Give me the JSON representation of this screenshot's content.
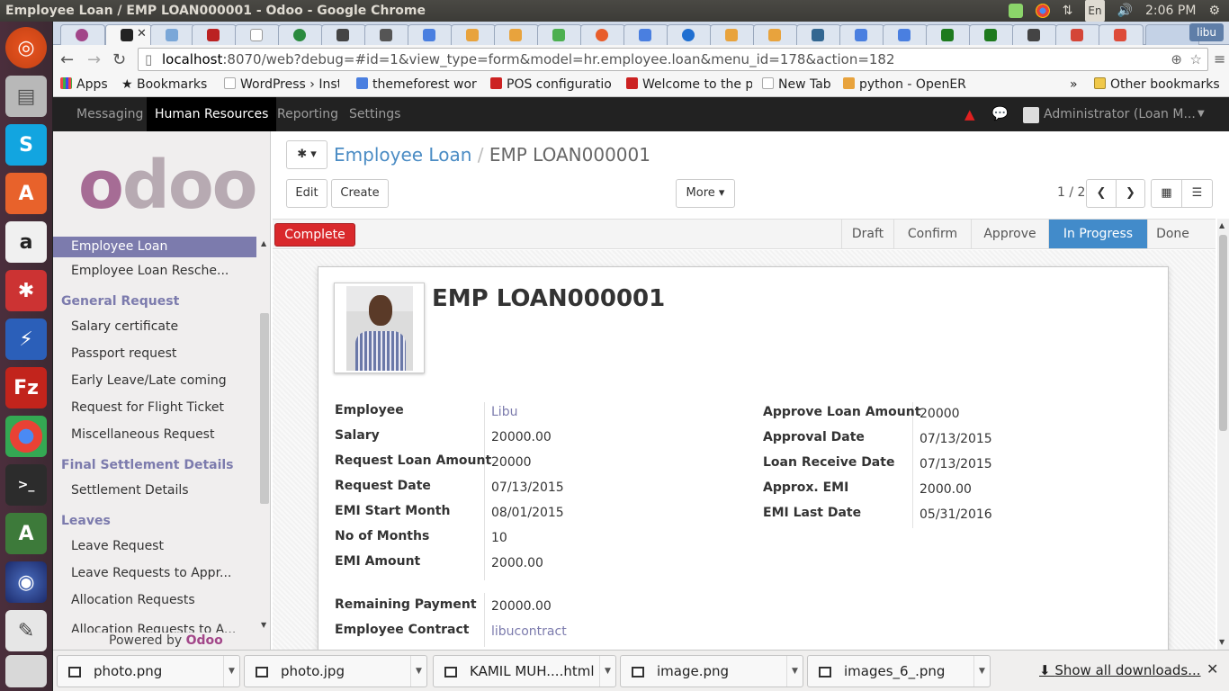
{
  "window": {
    "title": "Employee Loan / EMP LOAN000001 - Odoo - Google Chrome",
    "clock": "2:06 PM",
    "keyboard": "En",
    "user": "libu"
  },
  "browser": {
    "profile": "libu",
    "url_host": "localhost",
    "url_rest": ":8070/web?debug=#id=1&view_type=form&model=hr.employee.loan&menu_id=178&action=182",
    "bookmarks": [
      "Apps",
      "Bookmarks",
      "WordPress › Insta",
      "themeforest wor",
      "POS configuratio",
      "Welcome to the p",
      "New Tab",
      "python - OpenER"
    ],
    "other_bookmarks": "Other bookmarks"
  },
  "topmenu": {
    "items": [
      "Messaging",
      "Human Resources",
      "Reporting",
      "Settings"
    ],
    "user": "Administrator (Loan  M..."
  },
  "sidebar": {
    "items": [
      {
        "label": "Employee Loan",
        "kind": "sel"
      },
      {
        "label": "Employee Loan Resche...",
        "kind": "item"
      },
      {
        "label": "General Request",
        "kind": "hdr"
      },
      {
        "label": "Salary certificate",
        "kind": "item"
      },
      {
        "label": "Passport request",
        "kind": "item"
      },
      {
        "label": "Early Leave/Late coming",
        "kind": "item"
      },
      {
        "label": "Request for Flight Ticket",
        "kind": "item"
      },
      {
        "label": "Miscellaneous Request",
        "kind": "item"
      },
      {
        "label": "Final Settlement Details",
        "kind": "hdr"
      },
      {
        "label": "Settlement Details",
        "kind": "item"
      },
      {
        "label": "Leaves",
        "kind": "hdr"
      },
      {
        "label": "Leave Request",
        "kind": "item"
      },
      {
        "label": "Leave Requests to Appr...",
        "kind": "item"
      },
      {
        "label": "Allocation Requests",
        "kind": "item"
      },
      {
        "label": "Allocation Requests to A...",
        "kind": "item"
      }
    ],
    "powered_prefix": "Powered by ",
    "powered_brand": "Odoo",
    "logo": "odoo"
  },
  "form": {
    "breadcrumb_parent": "Employee Loan",
    "breadcrumb_sep": "/",
    "breadcrumb_current": "EMP LOAN000001",
    "edit": "Edit",
    "create": "Create",
    "more": "More",
    "pager": "1 / 2",
    "complete": "Complete",
    "stages": [
      "Draft",
      "Confirm",
      "Approve",
      "In Progress",
      "Done"
    ],
    "current_stage": "In Progress",
    "record_name": "EMP LOAN000001",
    "left_fields": [
      {
        "label": "Employee",
        "value": "Libu",
        "link": true
      },
      {
        "label": "Salary",
        "value": "20000.00"
      },
      {
        "label": "Request Loan Amount",
        "value": "20000"
      },
      {
        "label": "Request Date",
        "value": "07/13/2015"
      },
      {
        "label": "EMI Start Month",
        "value": "08/01/2015"
      },
      {
        "label": "No of Months",
        "value": "10"
      },
      {
        "label": "EMI Amount",
        "value": "2000.00"
      }
    ],
    "right_fields": [
      {
        "label": "Approve Loan Amount",
        "value": "20000"
      },
      {
        "label": "Approval Date",
        "value": "07/13/2015"
      },
      {
        "label": "Loan Receive Date",
        "value": "07/13/2015"
      },
      {
        "label": "Approx. EMI",
        "value": "2000.00"
      },
      {
        "label": "EMI Last Date",
        "value": "05/31/2016"
      }
    ],
    "bottom_fields": [
      {
        "label": "Remaining Payment",
        "value": "20000.00"
      },
      {
        "label": "Employee Contract",
        "value": "libucontract",
        "link": true
      }
    ]
  },
  "downloads": {
    "files": [
      "photo.png",
      "photo.jpg",
      "KAMIL MUH....html",
      "image.png",
      "images_6_.png"
    ],
    "show_all": "Show all downloads..."
  }
}
